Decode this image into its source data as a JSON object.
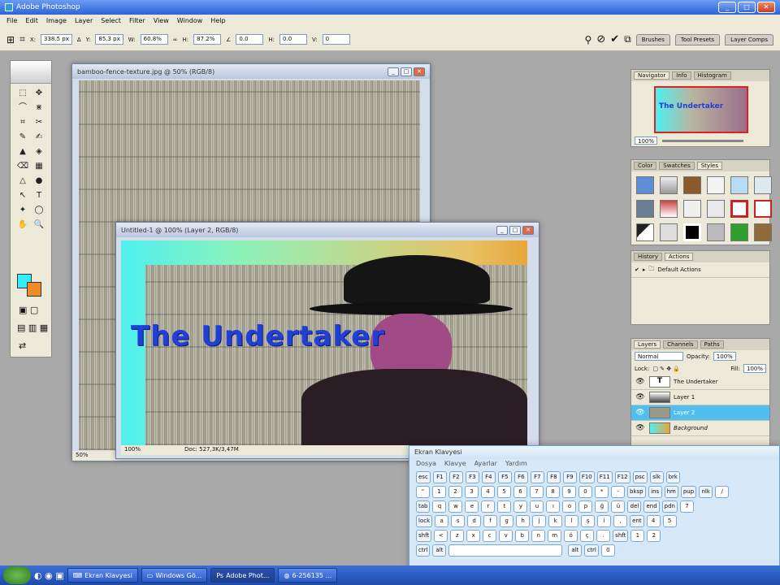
{
  "app": {
    "title": "Adobe Photoshop"
  },
  "menu": [
    "File",
    "Edit",
    "Image",
    "Layer",
    "Select",
    "Filter",
    "View",
    "Window",
    "Help"
  ],
  "options_bar": {
    "x_label": "X:",
    "x_value": "338.5 px",
    "y_label": "Y:",
    "y_value": "85.3 px",
    "w_label": "W:",
    "w_value": "60.8%",
    "h_label": "H:",
    "h_value": "87.2%",
    "angle_value": "0.0",
    "h_skew_label": "H:",
    "h_skew_value": "0.0",
    "v_skew_label": "V:",
    "v_skew_value": "0",
    "palette_tabs": [
      "Brushes",
      "Tool Presets",
      "Layer Comps"
    ]
  },
  "toolbox": {
    "tools": [
      "⬚",
      "✥",
      "⌒",
      "⋇",
      "⌗",
      "✂",
      "✎",
      "✍",
      "▲",
      "◈",
      "⌫",
      "▦",
      "△",
      "●",
      "↖",
      "T",
      "✦",
      "◯",
      "✋",
      "🔍"
    ],
    "fg_color": "#33eeff",
    "bg_color": "#ef8a2a"
  },
  "doc1": {
    "title": "bamboo-fence-texture.jpg @ 50% (RGB/8)",
    "zoom": "50%"
  },
  "doc2": {
    "title": "Untitled-1 @ 100% (Layer 2, RGB/8)",
    "zoom": "100%",
    "doc_size": "Doc: 527,3K/3,47M",
    "canvas_text": "The Undertaker"
  },
  "navigator": {
    "tabs": [
      "Navigator",
      "Info",
      "Histogram"
    ],
    "thumb_text": "The Undertaker",
    "zoom": "100%"
  },
  "styles_panel": {
    "tabs": [
      "Color",
      "Swatches",
      "Styles"
    ]
  },
  "actions_panel": {
    "tabs": [
      "History",
      "Actions"
    ],
    "item": "Default Actions"
  },
  "layers_panel": {
    "tabs": [
      "Layers",
      "Channels",
      "Paths"
    ],
    "blend_mode": "Normal",
    "opacity_label": "Opacity:",
    "opacity_value": "100%",
    "lock_label": "Lock:",
    "fill_label": "Fill:",
    "fill_value": "100%",
    "layers": [
      {
        "name": "The Undertaker",
        "type": "T"
      },
      {
        "name": "Layer 1",
        "type": "img"
      },
      {
        "name": "Layer 2",
        "type": "img",
        "selected": true
      },
      {
        "name": "Background",
        "type": "img"
      }
    ]
  },
  "osk": {
    "title": "Ekran Klavyesi",
    "menu": [
      "Dosya",
      "Klavye",
      "Ayarlar",
      "Yardım"
    ],
    "rows": [
      [
        "esc",
        "F1",
        "F2",
        "F3",
        "F4",
        "F5",
        "F6",
        "F7",
        "F8",
        "F9",
        "F10",
        "F11",
        "F12",
        "psc",
        "slk",
        "brk"
      ],
      [
        "\"",
        "1",
        "2",
        "3",
        "4",
        "5",
        "6",
        "7",
        "8",
        "9",
        "0",
        "*",
        "-",
        "bksp",
        "ins",
        "hm",
        "pup",
        "nlk",
        "/"
      ],
      [
        "tab",
        "q",
        "w",
        "e",
        "r",
        "t",
        "y",
        "u",
        "ı",
        "o",
        "p",
        "ğ",
        "ü",
        "del",
        "end",
        "pdn",
        "7"
      ],
      [
        "lock",
        "a",
        "s",
        "d",
        "f",
        "g",
        "h",
        "j",
        "k",
        "l",
        "ş",
        "i",
        ",",
        "ent",
        "4",
        "5"
      ],
      [
        "shft",
        "<",
        "z",
        "x",
        "c",
        "v",
        "b",
        "n",
        "m",
        "ö",
        "ç",
        ".",
        "shft",
        "1",
        "2"
      ],
      [
        "ctrl",
        "alt",
        "alt",
        "ctrl",
        "0"
      ]
    ]
  },
  "taskbar": {
    "items": [
      "Ekran Klavyesi",
      "Windows Gö...",
      "Adobe Phot...",
      "6-256135 ..."
    ]
  }
}
